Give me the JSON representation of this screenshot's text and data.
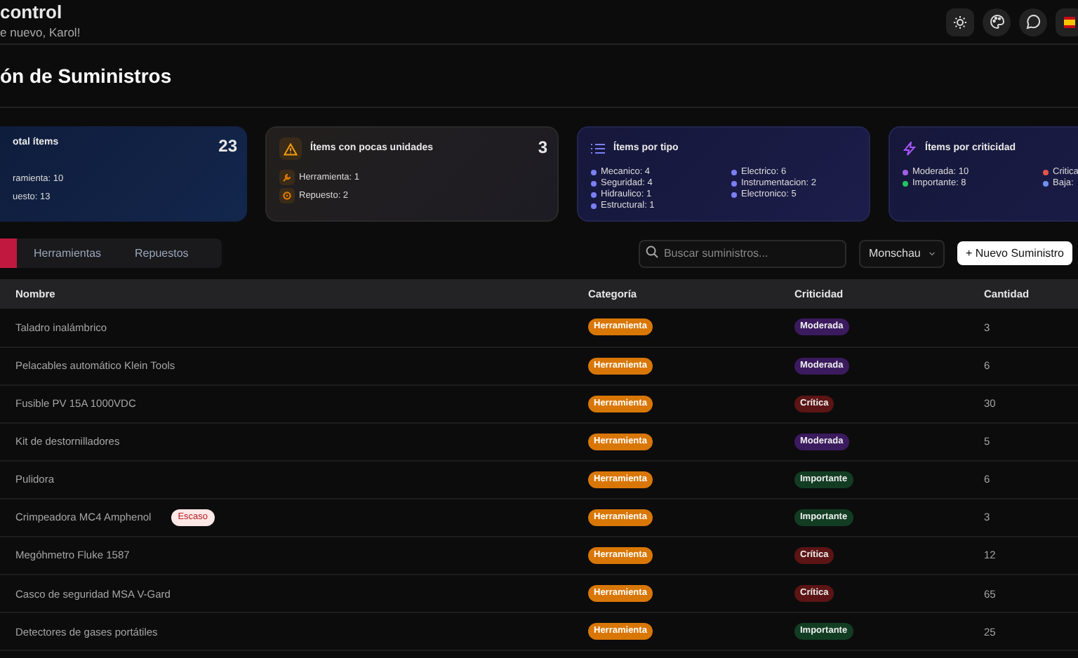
{
  "header": {
    "title": "control",
    "subtitle": "e nuevo, Karol!",
    "actions": [
      {
        "kind": "sun"
      },
      {
        "kind": "palette"
      },
      {
        "kind": "chat"
      },
      {
        "kind": "flag"
      }
    ]
  },
  "page_title": "ón de Suministros",
  "stat_cards": [
    {
      "kind": "total",
      "title": "otal ítems",
      "value": "23",
      "items": [
        {
          "text": "ramienta: 10"
        },
        {
          "text": "uesto: 13"
        }
      ]
    },
    {
      "kind": "low",
      "title": "Ítems con pocas unidades",
      "value": "3",
      "items": [
        {
          "text": "Herramienta: 1",
          "kind": "wrench"
        },
        {
          "text": "Repuesto: 2",
          "kind": "gear"
        }
      ]
    },
    {
      "kind": "type",
      "title": "Ítems por tipo",
      "items": [
        {
          "text": "Mecanico: 4",
          "color": "#7b7ff5"
        },
        {
          "text": "Seguridad: 4",
          "color": "#7b7ff5"
        },
        {
          "text": "Hidraulico: 1",
          "color": "#7b7ff5"
        },
        {
          "text": "Estructural: 1",
          "color": "#7b7ff5"
        },
        {
          "text": "Electrico: 6",
          "color": "#7b7ff5"
        },
        {
          "text": "Instrumentacion: 2",
          "color": "#7b7ff5"
        },
        {
          "text": "Electronico: 5",
          "color": "#7b7ff5"
        }
      ]
    },
    {
      "kind": "criticality",
      "title": "Ítems por criticidad",
      "items": [
        {
          "text": "Moderada: 10",
          "color": "#a35ee8"
        },
        {
          "text": "Importante: 8",
          "color": "#22c55e"
        },
        {
          "text": "Critica",
          "color": "#e5534b"
        },
        {
          "text": "Baja:",
          "color": "#6f8ff5"
        }
      ]
    }
  ],
  "tabs": [
    {
      "selected": true
    },
    {
      "label": "Herramientas",
      "selected": false
    },
    {
      "label": "Repuestos",
      "selected": false
    }
  ],
  "search": {
    "placeholder": "Buscar suministros..."
  },
  "location_select": {
    "value": "Monschau"
  },
  "new_button": "+ Nuevo Suministro",
  "table": {
    "columns": [
      "Nombre",
      "Categoría",
      "Criticidad",
      "Cantidad"
    ],
    "rows": [
      {
        "name": "Taladro inalámbrico",
        "category": "Herramienta",
        "criticality": {
          "text": "Moderada",
          "color": "#3b1a5e"
        },
        "quantity": "3"
      },
      {
        "name": "Pelacables automático Klein Tools",
        "category": "Herramienta",
        "criticality": {
          "text": "Moderada",
          "color": "#3b1a5e"
        },
        "quantity": "6"
      },
      {
        "name": "Fusible PV 15A 1000VDC",
        "category": "Herramienta",
        "criticality": {
          "text": "Crítica",
          "color": "#5c1414"
        },
        "quantity": "30"
      },
      {
        "name": "Kit de destornilladores",
        "category": "Herramienta",
        "criticality": {
          "text": "Moderada",
          "color": "#3b1a5e"
        },
        "quantity": "5"
      },
      {
        "name": "Pulidora",
        "category": "Herramienta",
        "criticality": {
          "text": "Importante",
          "color": "#123d22"
        },
        "quantity": "6"
      },
      {
        "name": "Crimpeadora MC4 Amphenol",
        "flag": "Escaso",
        "category": "Herramienta",
        "criticality": {
          "text": "Importante",
          "color": "#123d22"
        },
        "quantity": "3"
      },
      {
        "name": "Megóhmetro Fluke 1587",
        "category": "Herramienta",
        "criticality": {
          "text": "Crítica",
          "color": "#5c1414"
        },
        "quantity": "12"
      },
      {
        "name": "Casco de seguridad MSA V-Gard",
        "category": "Herramienta",
        "criticality": {
          "text": "Crítica",
          "color": "#5c1414"
        },
        "quantity": "65"
      },
      {
        "name": "Detectores de gases portátiles",
        "category": "Herramienta",
        "criticality": {
          "text": "Importante",
          "color": "#123d22"
        },
        "quantity": "25"
      }
    ]
  }
}
